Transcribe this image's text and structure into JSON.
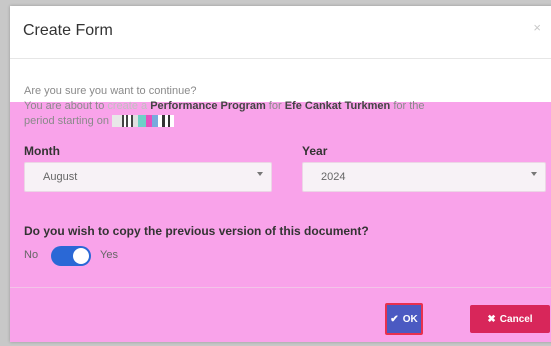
{
  "modal": {
    "title": "Create Form",
    "close_glyph": "×",
    "message": {
      "line1": "Are you sure you want to continue?",
      "line2_prefix": "You are about to ",
      "line2_faint": "create a ",
      "program": "Performance Program",
      "for_text": " for ",
      "person": "Efe Cankat Turkmen",
      "tail": " for the",
      "line3": "period starting on "
    },
    "month": {
      "label": "Month",
      "value": "August"
    },
    "year": {
      "label": "Year",
      "value": "2024"
    },
    "copy_question": "Do you wish to copy the previous version of this document?",
    "toggle": {
      "off_label": "No",
      "on_label": "Yes",
      "state": "on"
    },
    "buttons": {
      "ok": {
        "label": "OK",
        "icon": "check-icon"
      },
      "cancel": {
        "label": "Cancel",
        "icon": "x-icon"
      }
    }
  },
  "colors": {
    "overlay": "#f9a3ea",
    "ok_button": "#4b5ac2",
    "ok_border": "#e8304f",
    "cancel_button": "#d8265a",
    "toggle_on": "#2a68d6"
  }
}
